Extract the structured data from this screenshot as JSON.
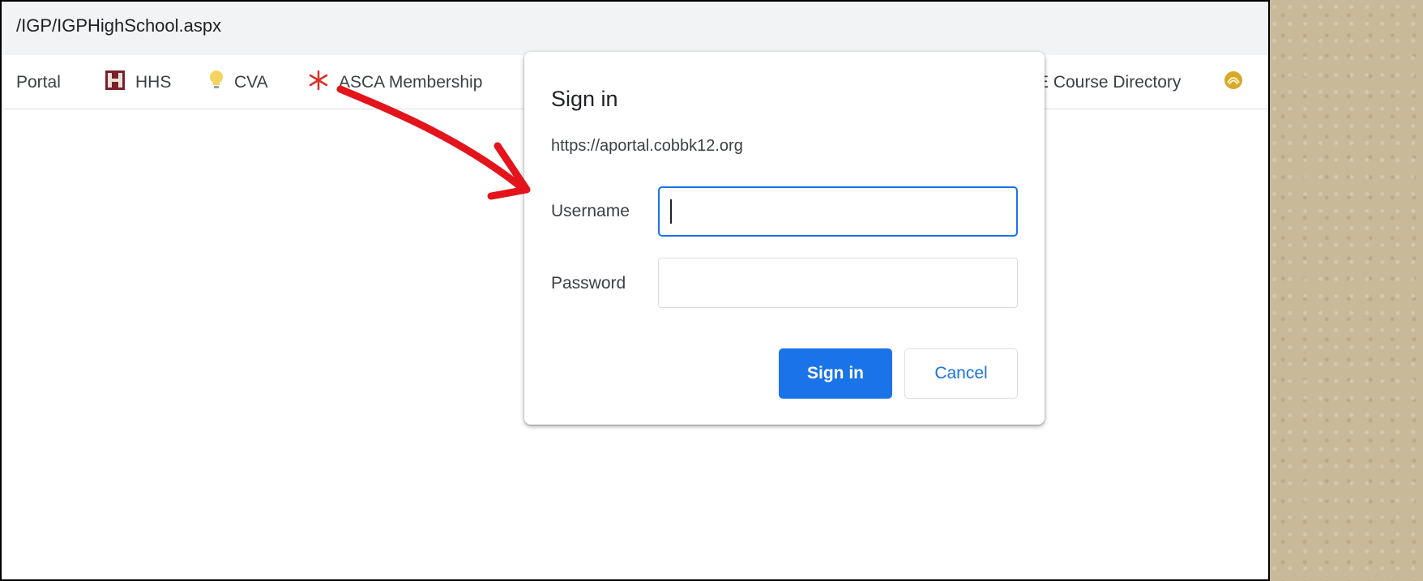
{
  "browser": {
    "address": "/IGP/IGPHighSchool.aspx"
  },
  "bookmarks": {
    "items": [
      {
        "label": "Portal",
        "icon": "none"
      },
      {
        "label": "HHS",
        "icon": "school-logo-icon"
      },
      {
        "label": "CVA",
        "icon": "lightbulb-icon"
      },
      {
        "label": "ASCA Membership",
        "icon": "asterisk-logo-icon"
      },
      {
        "label": "E Course Directory",
        "icon": "none"
      },
      {
        "label": "",
        "icon": "gold-swirl-icon"
      }
    ]
  },
  "dialog": {
    "title": "Sign in",
    "origin": "https://aportal.cobbk12.org",
    "username_label": "Username",
    "username_value": "",
    "password_label": "Password",
    "password_value": "",
    "signin_label": "Sign in",
    "cancel_label": "Cancel"
  },
  "annotation": {
    "color": "#e3141b",
    "icon": "red-arrow-annotation"
  },
  "colors": {
    "accent": "#1a73e8",
    "background_texture": "#c9bb9c"
  }
}
